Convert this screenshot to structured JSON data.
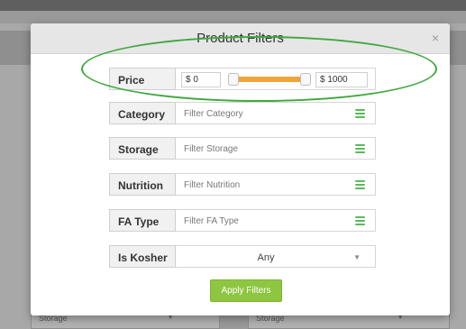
{
  "modal": {
    "title": "Product Filters",
    "close_glyph": "×"
  },
  "price": {
    "label": "Price",
    "min_value": "$ 0",
    "max_value": "$ 1000",
    "slider_range_fraction": [
      0,
      1
    ],
    "slider_color": "#f0a43a"
  },
  "filters": [
    {
      "label": "Category",
      "placeholder": "Filter Category",
      "icon": "menu-icon"
    },
    {
      "label": "Storage",
      "placeholder": "Filter Storage",
      "icon": "menu-icon"
    },
    {
      "label": "Nutrition",
      "placeholder": "Filter Nutrition",
      "icon": "menu-icon"
    },
    {
      "label": "FA Type",
      "placeholder": "Filter FA Type",
      "icon": "menu-icon"
    }
  ],
  "kosher": {
    "label": "Is Kosher",
    "selected": "Any",
    "arrow": "▼"
  },
  "apply_button": "Apply Filters",
  "background": {
    "left_field": "Storage",
    "right_field": "Storage",
    "arrow": "▼"
  },
  "colors": {
    "accent_green": "#8ec641",
    "icon_green": "#5cb85c",
    "highlight_ellipse": "#3fa83f"
  }
}
